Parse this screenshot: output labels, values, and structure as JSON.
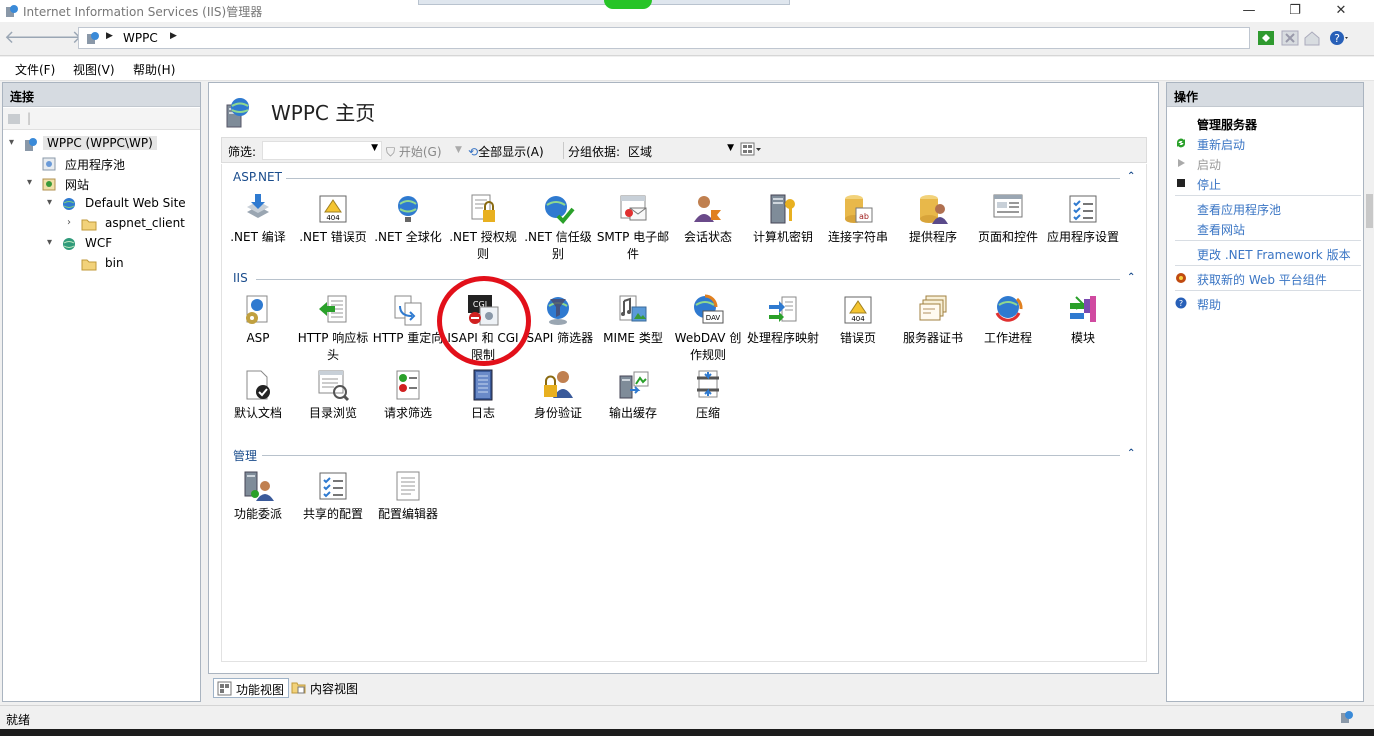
{
  "window": {
    "title": "Internet Information Services (IIS)管理器"
  },
  "address": {
    "crumb": "WPPC"
  },
  "menu": [
    "文件(F)",
    "视图(V)",
    "帮助(H)"
  ],
  "connections": {
    "header": "连接",
    "tree": [
      {
        "label": "WPPC (WPPC\\WP)",
        "expander": "▾"
      },
      {
        "label": "应用程序池",
        "expander": ""
      },
      {
        "label": "网站",
        "expander": "▾"
      },
      {
        "label": "Default Web Site",
        "expander": "▾"
      },
      {
        "label": "aspnet_client",
        "expander": "›"
      },
      {
        "label": "WCF",
        "expander": "▾"
      },
      {
        "label": "bin",
        "expander": ""
      }
    ]
  },
  "center": {
    "title": "WPPC 主页",
    "filter": {
      "label": "筛选:",
      "value": "",
      "start": "开始(G)",
      "show_all": "全部显示(A)",
      "group_by": "分组依据:",
      "group_value": "区域"
    },
    "groups": {
      "aspnet": {
        "title": "ASP.NET",
        "items": [
          {
            "label": ".NET 编译",
            "icon": "net-compile-icon"
          },
          {
            "label": ".NET 错误页",
            "icon": "net-error-page-icon"
          },
          {
            "label": ".NET 全球化",
            "icon": "net-globalization-icon"
          },
          {
            "label": ".NET 授权规则",
            "icon": "net-authorization-icon"
          },
          {
            "label": ".NET 信任级别",
            "icon": "net-trust-icon"
          },
          {
            "label": "SMTP 电子邮件",
            "icon": "smtp-email-icon"
          },
          {
            "label": "会话状态",
            "icon": "session-state-icon"
          },
          {
            "label": "计算机密钥",
            "icon": "machine-key-icon"
          },
          {
            "label": "连接字符串",
            "icon": "connection-strings-icon"
          },
          {
            "label": "提供程序",
            "icon": "providers-icon"
          },
          {
            "label": "页面和控件",
            "icon": "pages-controls-icon"
          },
          {
            "label": "应用程序设置",
            "icon": "app-settings-icon"
          }
        ]
      },
      "iis": {
        "title": "IIS",
        "items": [
          {
            "label": "ASP",
            "icon": "asp-icon"
          },
          {
            "label": "HTTP 响应标头",
            "icon": "http-response-headers-icon"
          },
          {
            "label": "HTTP 重定向",
            "icon": "http-redirect-icon"
          },
          {
            "label": "ISAPI 和 CGI 限制",
            "icon": "isapi-cgi-icon"
          },
          {
            "label": "ISAPI 筛选器",
            "icon": "isapi-filters-icon"
          },
          {
            "label": "MIME 类型",
            "icon": "mime-types-icon"
          },
          {
            "label": "WebDAV 创作规则",
            "icon": "webdav-icon"
          },
          {
            "label": "处理程序映射",
            "icon": "handler-mappings-icon"
          },
          {
            "label": "错误页",
            "icon": "error-pages-icon"
          },
          {
            "label": "服务器证书",
            "icon": "server-certificates-icon"
          },
          {
            "label": "工作进程",
            "icon": "worker-processes-icon"
          },
          {
            "label": "模块",
            "icon": "modules-icon"
          },
          {
            "label": "默认文档",
            "icon": "default-document-icon"
          },
          {
            "label": "目录浏览",
            "icon": "directory-browsing-icon"
          },
          {
            "label": "请求筛选",
            "icon": "request-filtering-icon"
          },
          {
            "label": "日志",
            "icon": "logging-icon"
          },
          {
            "label": "身份验证",
            "icon": "authentication-icon"
          },
          {
            "label": "输出缓存",
            "icon": "output-caching-icon"
          },
          {
            "label": "压缩",
            "icon": "compression-icon"
          }
        ]
      },
      "management": {
        "title": "管理",
        "items": [
          {
            "label": "功能委派",
            "icon": "feature-delegation-icon"
          },
          {
            "label": "共享的配置",
            "icon": "shared-configuration-icon"
          },
          {
            "label": "配置编辑器",
            "icon": "configuration-editor-icon"
          }
        ]
      }
    },
    "view_tabs": {
      "features": "功能视图",
      "content": "内容视图"
    }
  },
  "actions": {
    "header": "操作",
    "section": "管理服务器",
    "restart": "重新启动",
    "start": "启动",
    "stop": "停止",
    "view_pools": "查看应用程序池",
    "view_sites": "查看网站",
    "change_framework": "更改 .NET Framework 版本",
    "get_components": "获取新的 Web 平台组件",
    "help": "帮助"
  },
  "status": {
    "text": "就绪"
  },
  "colors": {
    "link": "#3a75c4",
    "highlight_ring": "#e2101a",
    "group_title": "#1a4c8c"
  }
}
